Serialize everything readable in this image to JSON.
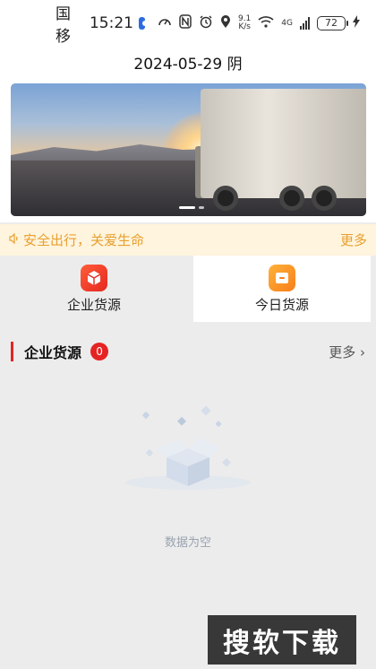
{
  "status_bar": {
    "carrier": "中国移动",
    "time": "15:21",
    "net_speed_value": "9.1",
    "net_speed_unit": "K/s",
    "network_type": "4G",
    "battery": "72"
  },
  "header": {
    "date": "2024-05-29",
    "weather": "阴"
  },
  "banner": {
    "slide_count": 2,
    "active_index": 0
  },
  "notice": {
    "text": "安全出行，关爱生命",
    "more_label": "更多",
    "accent_color": "#e8a030"
  },
  "tabs": [
    {
      "label": "企业货源",
      "icon": "red-cube-icon",
      "selected": false
    },
    {
      "label": "今日货源",
      "icon": "orange-box-icon",
      "selected": true
    }
  ],
  "section": {
    "title": "企业货源",
    "count": "0",
    "more_label": "更多"
  },
  "empty_state": {
    "text": "数据为空",
    "icon": "empty-box-icon"
  },
  "watermark": {
    "text": "搜软下载"
  },
  "colors": {
    "primary_red": "#e52323",
    "notice_bg": "#fff4dd",
    "page_bg": "#ececec"
  }
}
